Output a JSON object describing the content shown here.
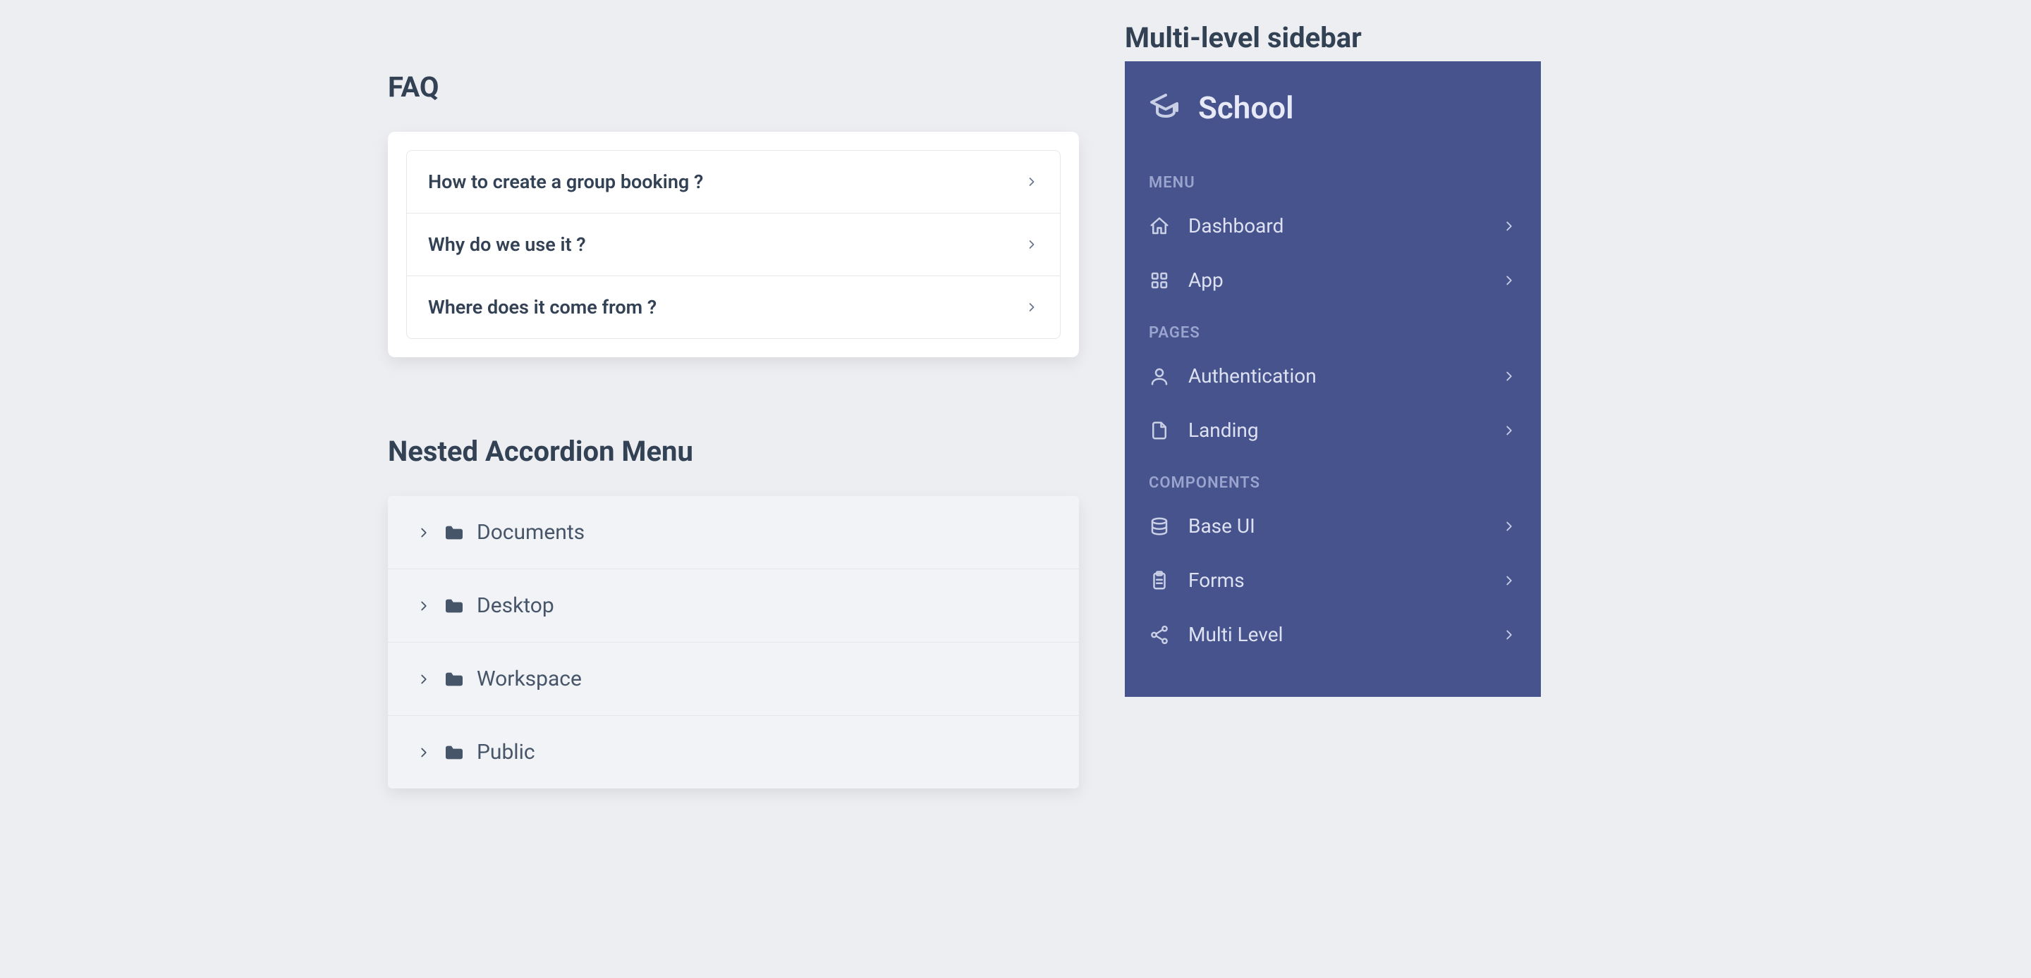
{
  "faq": {
    "title": "FAQ",
    "items": [
      {
        "q": "How to create a group booking ?"
      },
      {
        "q": "Why do we use it ?"
      },
      {
        "q": "Where does it come from ?"
      }
    ]
  },
  "accordion": {
    "title": "Nested Accordion Menu",
    "items": [
      {
        "label": "Documents"
      },
      {
        "label": "Desktop"
      },
      {
        "label": "Workspace"
      },
      {
        "label": "Public"
      }
    ]
  },
  "sidebar": {
    "title": "Multi-level sidebar",
    "brand": "School",
    "groups": [
      {
        "label": "MENU",
        "items": [
          {
            "label": "Dashboard",
            "icon": "home"
          },
          {
            "label": "App",
            "icon": "grid"
          }
        ]
      },
      {
        "label": "PAGES",
        "items": [
          {
            "label": "Authentication",
            "icon": "user"
          },
          {
            "label": "Landing",
            "icon": "file"
          }
        ]
      },
      {
        "label": "COMPONENTS",
        "items": [
          {
            "label": "Base UI",
            "icon": "database"
          },
          {
            "label": "Forms",
            "icon": "clipboard"
          },
          {
            "label": "Multi Level",
            "icon": "share"
          }
        ]
      }
    ]
  }
}
